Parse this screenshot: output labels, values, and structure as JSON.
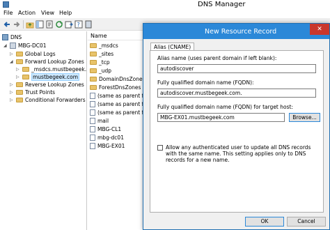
{
  "window": {
    "title": "DNS Manager"
  },
  "menu": [
    "File",
    "Action",
    "View",
    "Help"
  ],
  "tree": {
    "items": [
      {
        "label": "DNS",
        "icon": "dns-icon"
      },
      {
        "label": "MBG-DC01",
        "icon": "server-icon"
      },
      {
        "label": "Global Logs",
        "icon": "folder-icon"
      },
      {
        "label": "Forward Lookup Zones",
        "icon": "folder-icon"
      },
      {
        "label": "_msdcs.mustbegeek.",
        "icon": "folder-icon"
      },
      {
        "label": "mustbegeek.com",
        "icon": "folder-icon"
      },
      {
        "label": "Reverse Lookup Zones",
        "icon": "folder-icon"
      },
      {
        "label": "Trust Points",
        "icon": "folder-icon"
      },
      {
        "label": "Conditional Forwarders",
        "icon": "folder-icon"
      }
    ]
  },
  "list": {
    "column_name": "Name",
    "rows": [
      {
        "label": "_msdcs",
        "icon": "folder-icon"
      },
      {
        "label": "_sites",
        "icon": "folder-icon"
      },
      {
        "label": "_tcp",
        "icon": "folder-icon"
      },
      {
        "label": "_udp",
        "icon": "folder-icon"
      },
      {
        "label": "DomainDnsZones",
        "icon": "folder-icon"
      },
      {
        "label": "ForestDnsZones",
        "icon": "folder-icon"
      },
      {
        "label": "(same as parent fold",
        "icon": "record-icon"
      },
      {
        "label": "(same as parent fold",
        "icon": "record-icon"
      },
      {
        "label": "(same as parent fold",
        "icon": "record-icon"
      },
      {
        "label": "mail",
        "icon": "record-icon"
      },
      {
        "label": "MBG-CL1",
        "icon": "record-icon"
      },
      {
        "label": "mbg-dc01",
        "icon": "record-icon"
      },
      {
        "label": "MBG-EX01",
        "icon": "record-icon"
      }
    ]
  },
  "dialog": {
    "title": "New Resource Record",
    "tab": "Alias (CNAME)",
    "alias_label": "Alias name (uses parent domain if left blank):",
    "alias_value": "autodiscover",
    "fqdn_label": "Fully qualified domain name (FQDN):",
    "fqdn_value": "autodiscover.mustbegeek.com.",
    "target_label": "Fully qualified domain name (FQDN) for target host:",
    "target_value": "MBG-EX01.mustbegeek.com",
    "browse_label": "Browse...",
    "checkbox_text": "Allow any authenticated user to update all DNS records with the same name. This setting applies only to DNS records for a new name.",
    "ok_label": "OK",
    "cancel_label": "Cancel"
  }
}
